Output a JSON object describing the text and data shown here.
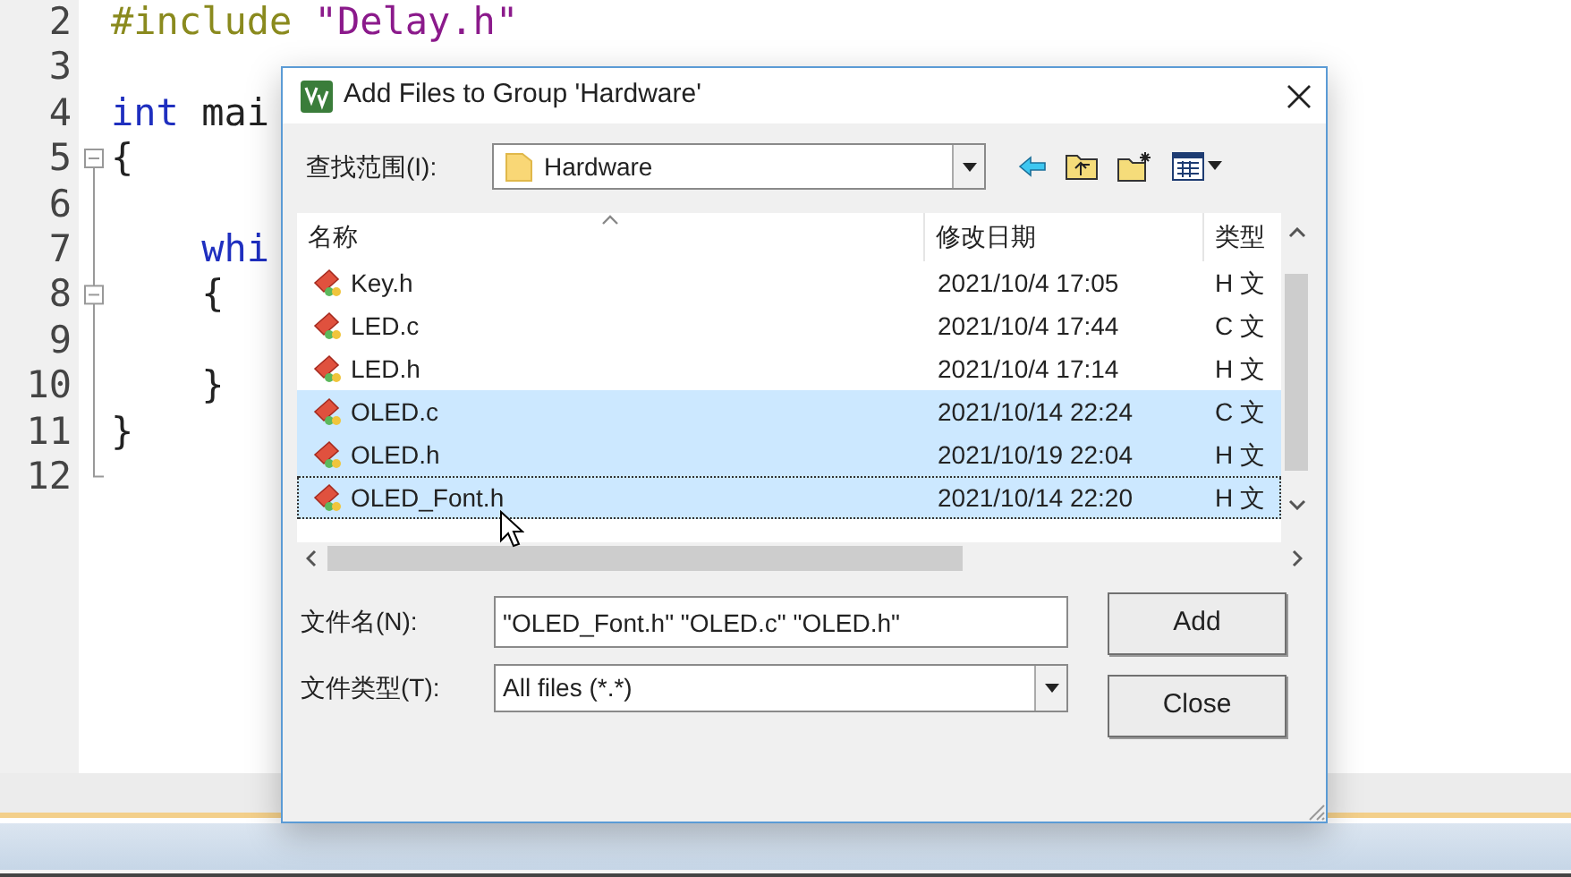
{
  "editor": {
    "lines": [
      {
        "number": "2",
        "fold_box": false,
        "tokens": [
          {
            "kind": "directive",
            "text": "#include "
          },
          {
            "kind": "string",
            "text": "\"Delay.h\""
          }
        ]
      },
      {
        "number": "3",
        "fold_box": false
      },
      {
        "number": "4",
        "fold_box": false,
        "tokens": [
          {
            "kind": "keyword",
            "text": "int"
          },
          {
            "kind": "plain",
            "text": " mai"
          }
        ]
      },
      {
        "number": "5",
        "fold_box": true,
        "tokens": [
          {
            "kind": "plain",
            "text": "{"
          }
        ]
      },
      {
        "number": "6",
        "fold_box": false
      },
      {
        "number": "7",
        "fold_box": false,
        "tokens": [
          {
            "kind": "keyword",
            "text": "    whi"
          }
        ]
      },
      {
        "number": "8",
        "fold_box": true,
        "tokens": [
          {
            "kind": "plain",
            "text": "    {"
          }
        ]
      },
      {
        "number": "9",
        "fold_box": false
      },
      {
        "number": "10",
        "fold_box": false,
        "tokens": [
          {
            "kind": "plain",
            "text": "    }"
          }
        ]
      },
      {
        "number": "11",
        "fold_box": false,
        "tokens": [
          {
            "kind": "plain",
            "text": "}"
          }
        ]
      },
      {
        "number": "12",
        "fold_box": false
      }
    ]
  },
  "dialog": {
    "title": "Add Files to Group 'Hardware'",
    "look_in": {
      "label": "查找范围(I):",
      "value": "Hardware"
    },
    "file_list": {
      "columns": [
        "名称",
        "修改日期",
        "类型"
      ],
      "rows": [
        {
          "name": "Key.h",
          "date": "2021/10/4 17:05",
          "type": "H 文",
          "selected": false,
          "focused": false
        },
        {
          "name": "LED.c",
          "date": "2021/10/4 17:44",
          "type": "C 文",
          "selected": false,
          "focused": false
        },
        {
          "name": "LED.h",
          "date": "2021/10/4 17:14",
          "type": "H 文",
          "selected": false,
          "focused": false
        },
        {
          "name": "OLED.c",
          "date": "2021/10/14 22:24",
          "type": "C 文",
          "selected": true,
          "focused": false
        },
        {
          "name": "OLED.h",
          "date": "2021/10/19 22:04",
          "type": "H 文",
          "selected": true,
          "focused": false
        },
        {
          "name": "OLED_Font.h",
          "date": "2021/10/14 22:20",
          "type": "H 文",
          "selected": true,
          "focused": true
        }
      ]
    },
    "file_name": {
      "label": "文件名(N):",
      "value": "\"OLED_Font.h\" \"OLED.c\" \"OLED.h\""
    },
    "file_type": {
      "label": "文件类型(T):",
      "value": "All files (*.*)"
    },
    "buttons": [
      "Add",
      "Close"
    ]
  }
}
